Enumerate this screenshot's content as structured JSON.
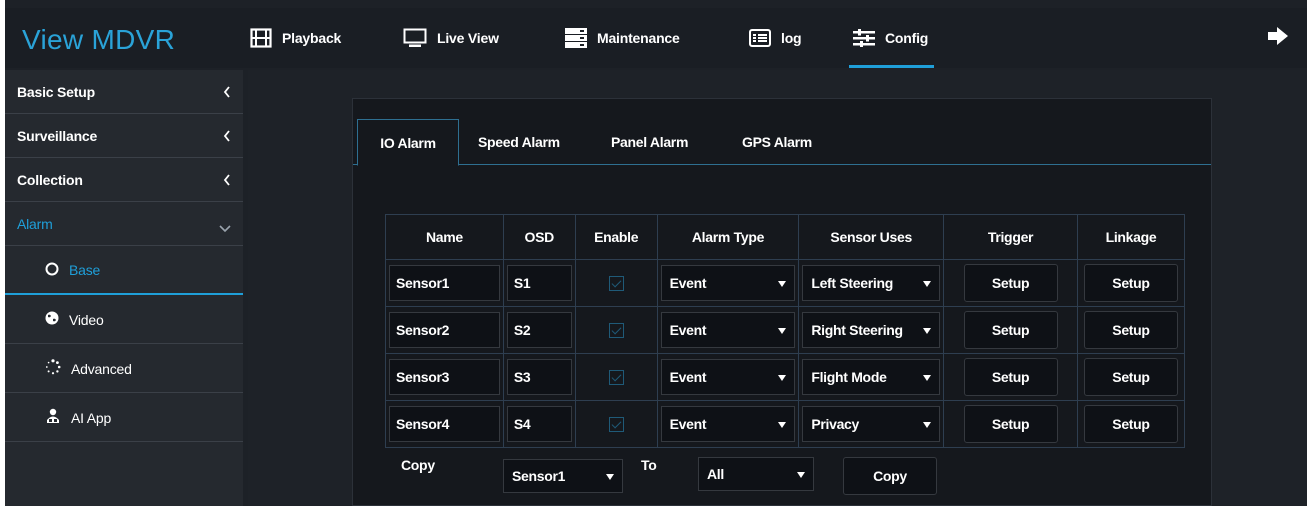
{
  "app": {
    "title": "View MDVR"
  },
  "nav": [
    {
      "label": "Playback",
      "icon": "film-icon"
    },
    {
      "label": "Live View",
      "icon": "monitor-icon"
    },
    {
      "label": "Maintenance",
      "icon": "server-icon"
    },
    {
      "label": "log",
      "icon": "list-icon"
    },
    {
      "label": "Config",
      "icon": "sliders-icon",
      "active": true
    }
  ],
  "sidebar": {
    "sections": [
      {
        "label": "Basic Setup"
      },
      {
        "label": "Surveillance"
      },
      {
        "label": "Collection"
      },
      {
        "label": "Alarm",
        "open": true
      }
    ],
    "sub_items": [
      {
        "label": "Base",
        "icon": "circle-icon",
        "active": true
      },
      {
        "label": "Video",
        "icon": "globe-icon"
      },
      {
        "label": "Advanced",
        "icon": "spinner-icon"
      },
      {
        "label": "AI App",
        "icon": "users-icon"
      }
    ]
  },
  "tabs": [
    "IO Alarm",
    "Speed Alarm",
    "Panel Alarm",
    "GPS Alarm"
  ],
  "table": {
    "headers": [
      "Name",
      "OSD",
      "Enable",
      "Alarm Type",
      "Sensor Uses",
      "Trigger",
      "Linkage"
    ],
    "rows": [
      {
        "name": "Sensor1",
        "osd": "S1",
        "alarm_type": "Event",
        "sensor_use": "Left Steering",
        "trigger": "Setup",
        "linkage": "Setup"
      },
      {
        "name": "Sensor2",
        "osd": "S2",
        "alarm_type": "Event",
        "sensor_use": "Right Steering",
        "trigger": "Setup",
        "linkage": "Setup"
      },
      {
        "name": "Sensor3",
        "osd": "S3",
        "alarm_type": "Event",
        "sensor_use": "Flight Mode",
        "trigger": "Setup",
        "linkage": "Setup"
      },
      {
        "name": "Sensor4",
        "osd": "S4",
        "alarm_type": "Event",
        "sensor_use": "Privacy",
        "trigger": "Setup",
        "linkage": "Setup"
      }
    ]
  },
  "copy": {
    "label": "Copy",
    "from": "Sensor1",
    "to_label": "To",
    "to": "All",
    "button": "Copy"
  },
  "colors": {
    "accent": "#1f9fd9",
    "background": "#1d2127",
    "panel": "#15181d"
  }
}
